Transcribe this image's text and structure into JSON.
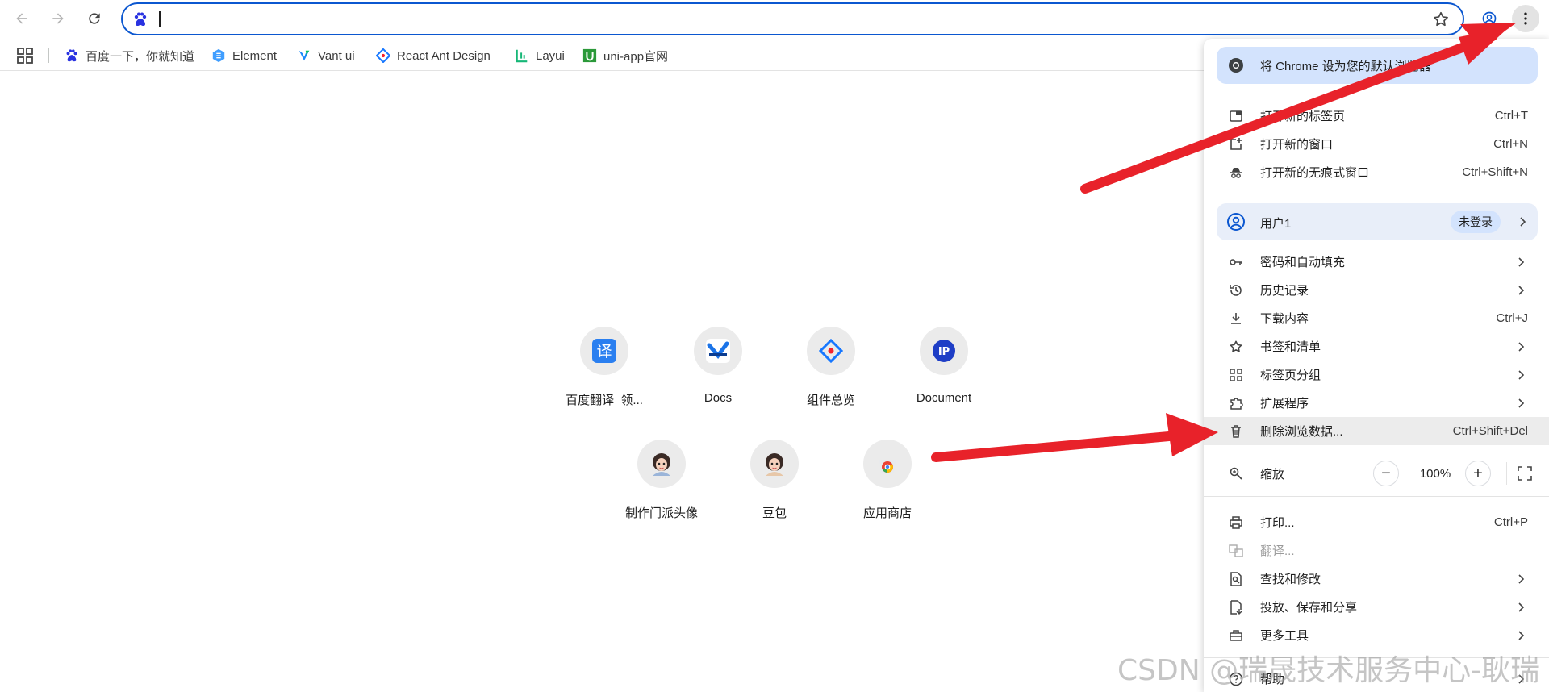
{
  "toolbar": {
    "back_icon": "arrow-left-icon",
    "forward_icon": "arrow-right-icon",
    "reload_icon": "reload-icon",
    "omnibox_value": "",
    "site_icon": "baidu-paw-icon",
    "star_icon": "star-outline-icon",
    "profile_icon": "account-circle-icon",
    "menu_icon": "three-dots-vertical-icon"
  },
  "bookmarks": {
    "items": [
      {
        "label": "百度一下，你就知道",
        "icon": "baidu-paw-icon"
      },
      {
        "label": "Element",
        "icon": "element-icon"
      },
      {
        "label": "Vant ui",
        "icon": "vant-icon"
      },
      {
        "label": "React Ant Design",
        "icon": "ant-design-icon"
      },
      {
        "label": "Layui",
        "icon": "layui-icon"
      },
      {
        "label": "uni-app官网",
        "icon": "uni-app-icon"
      }
    ]
  },
  "shortcuts": [
    {
      "label": "百度翻译_领...",
      "icon": "translate-icon"
    },
    {
      "label": "Docs",
      "icon": "docs-icon"
    },
    {
      "label": "组件总览",
      "icon": "ant-design-icon"
    },
    {
      "label": "Document",
      "icon": "ip-icon"
    },
    {
      "label": "制作门派头像",
      "icon": "avatar-icon"
    },
    {
      "label": "豆包",
      "icon": "avatar-icon"
    },
    {
      "label": "应用商店",
      "icon": "chrome-web-store-icon"
    }
  ],
  "menu": {
    "default_browser": "将 Chrome 设为您的默认浏览器",
    "group1": [
      {
        "label": "打开新的标签页",
        "shortcut": "Ctrl+T",
        "icon": "new-tab-icon"
      },
      {
        "label": "打开新的窗口",
        "shortcut": "Ctrl+N",
        "icon": "new-window-icon"
      },
      {
        "label": "打开新的无痕式窗口",
        "shortcut": "Ctrl+Shift+N",
        "icon": "incognito-icon"
      }
    ],
    "profile": {
      "name": "用户1",
      "status": "未登录",
      "icon": "account-circle-icon"
    },
    "group2": [
      {
        "label": "密码和自动填充",
        "icon": "key-icon",
        "submenu": true
      },
      {
        "label": "历史记录",
        "icon": "history-icon",
        "submenu": true
      },
      {
        "label": "下载内容",
        "shortcut": "Ctrl+J",
        "icon": "download-icon"
      },
      {
        "label": "书签和清单",
        "icon": "star-outline-icon",
        "submenu": true
      },
      {
        "label": "标签页分组",
        "icon": "tab-groups-icon",
        "submenu": true
      },
      {
        "label": "扩展程序",
        "icon": "extension-icon",
        "submenu": true
      },
      {
        "label": "删除浏览数据...",
        "shortcut": "Ctrl+Shift+Del",
        "icon": "trash-icon"
      }
    ],
    "zoom": {
      "label": "缩放",
      "value": "100%",
      "minus": "−",
      "plus": "+",
      "icon": "zoom-icon"
    },
    "group3": [
      {
        "label": "打印...",
        "shortcut": "Ctrl+P",
        "icon": "print-icon"
      },
      {
        "label": "翻译...",
        "icon": "translate-icon",
        "disabled": true
      },
      {
        "label": "查找和修改",
        "icon": "find-icon",
        "submenu": true
      },
      {
        "label": "投放、保存和分享",
        "icon": "cast-save-icon",
        "submenu": true
      },
      {
        "label": "更多工具",
        "icon": "toolbox-icon",
        "submenu": true
      },
      {
        "label": "帮助",
        "icon": "help-icon",
        "submenu": true
      }
    ]
  },
  "colors": {
    "accent": "#0b57d0",
    "menu_highlight": "#d3e3fd",
    "arrow": "#e8222a"
  },
  "watermark": "CSDN @瑞晟技术服务中心-耿瑞"
}
